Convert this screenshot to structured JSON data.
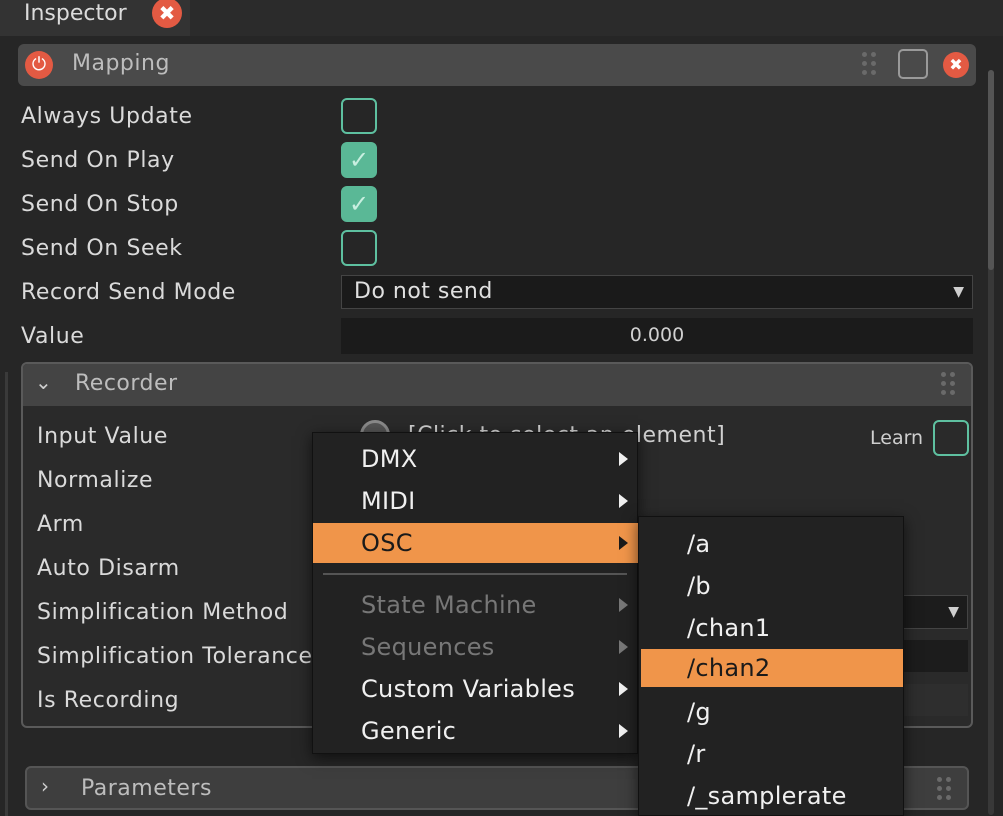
{
  "tab": {
    "title": "Inspector",
    "close_glyph": "✖"
  },
  "mapping": {
    "title": "Mapping",
    "power_icon": "⏻",
    "close_glyph": "✖",
    "rows": [
      {
        "label": "Always Update",
        "checked": false
      },
      {
        "label": "Send On Play",
        "checked": true
      },
      {
        "label": "Send On Stop",
        "checked": true
      },
      {
        "label": "Send On Seek",
        "checked": false
      }
    ],
    "record_send_mode": {
      "label": "Record Send Mode",
      "value": "Do not send"
    },
    "value": {
      "label": "Value",
      "value": "0.000"
    }
  },
  "recorder": {
    "title": "Recorder",
    "input_value": {
      "label": "Input Value",
      "target_text": "[Click to select an element]",
      "learn_label": "Learn"
    },
    "labels": {
      "normalize": "Normalize",
      "arm": "Arm",
      "auto_disarm": "Auto Disarm",
      "simplification_method": "Simplification Method",
      "simplification_tolerance": "Simplification Tolerance",
      "is_recording": "Is Recording"
    }
  },
  "parameters": {
    "title": "Parameters"
  },
  "context_menu": {
    "items": [
      {
        "label": "DMX",
        "enabled": true
      },
      {
        "label": "MIDI",
        "enabled": true
      },
      {
        "label": "OSC",
        "enabled": true,
        "selected": true
      },
      {
        "label": "State Machine",
        "enabled": false
      },
      {
        "label": "Sequences",
        "enabled": false
      },
      {
        "label": "Custom Variables",
        "enabled": true
      },
      {
        "label": "Generic",
        "enabled": true
      }
    ]
  },
  "osc_submenu": {
    "items": [
      "/a",
      "/b",
      "/chan1",
      "/chan2",
      "/g",
      "/r",
      "/_samplerate"
    ],
    "selected": "/chan2"
  },
  "colors": {
    "accent": "#f0954a",
    "checkbox": "#5ab896",
    "close": "#e35a43"
  }
}
